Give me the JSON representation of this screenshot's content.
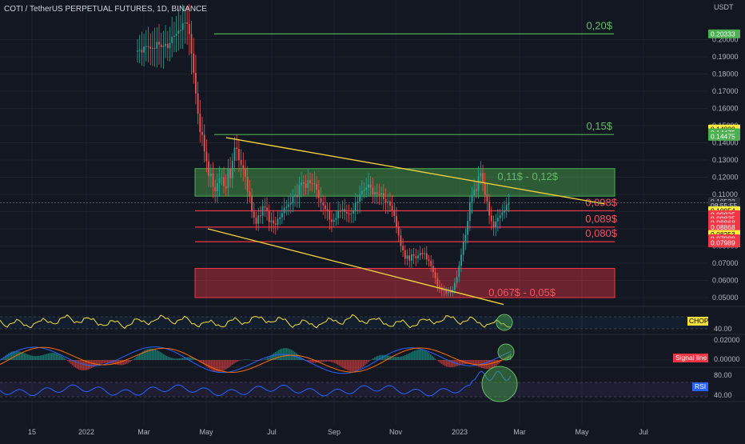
{
  "header": {
    "title": "COTI / TetherUS PERPETUAL FUTURES, 1D, BINANCE",
    "currency": "USDT"
  },
  "colors": {
    "background": "#131722",
    "grid": "#1e222d",
    "green_level": "#4caf50",
    "green_text": "#66bb6a",
    "red_level": "#f23645",
    "red_text": "#f7525f",
    "zone_green_fill": "rgba(76,175,80,0.45)",
    "zone_red_fill": "rgba(242,54,69,0.40)",
    "trendline": "#f0d03c",
    "candle_up": "#26a69a",
    "candle_down": "#ef5350",
    "chop_line": "#f5e03c",
    "rsi_line": "#2962ff",
    "macd_line": "#2962ff",
    "signal_line": "#ff6d00",
    "highlight": "rgba(76,175,80,0.45)"
  },
  "chart_data": {
    "type": "candlestick",
    "x_ticks": [
      "15",
      "2022",
      "Mar",
      "May",
      "Jul",
      "Sep",
      "Nov",
      "2023",
      "Mar",
      "May",
      "Jul"
    ],
    "y_ticks": [
      "0.20000",
      "0.19000",
      "0.18000",
      "0.17000",
      "0.16000",
      "0.15000",
      "0.14000",
      "0.13000",
      "0.12000",
      "0.11000",
      "0.10000",
      "0.09000",
      "0.08000",
      "0.07000",
      "0.06000",
      "0.05000"
    ],
    "ylim": [
      0.049,
      0.212
    ],
    "horizontal_levels": [
      {
        "value": 0.2033,
        "label": "0,20$",
        "color": "green"
      },
      {
        "value": 0.1448,
        "label": "0,15$",
        "color": "green"
      },
      {
        "value": 0.1005,
        "label": "0,098$",
        "color": "red"
      },
      {
        "value": 0.091,
        "label": "0,089$",
        "color": "red"
      },
      {
        "value": 0.0825,
        "label": "0,080$",
        "color": "red"
      }
    ],
    "zones": [
      {
        "top": 0.125,
        "bottom": 0.109,
        "label": "0,11$ - 0,12$",
        "color": "green"
      },
      {
        "top": 0.067,
        "bottom": 0.05,
        "label": "0,067$ - 0,05$",
        "color": "red"
      }
    ],
    "trendlines": [
      {
        "from": {
          "x": "May 2022",
          "y": 0.143
        },
        "to": {
          "x": "Apr 2023",
          "y": 0.105
        }
      },
      {
        "from": {
          "x": "Apr 2022",
          "y": 0.09
        },
        "to": {
          "x": "Feb 2023",
          "y": 0.046
        }
      }
    ],
    "price_badges": [
      {
        "text": "0.20333",
        "bg": "#4caf50",
        "fg": "#ffffff",
        "value": 0.20333
      },
      {
        "text": "0.14800",
        "bg": "#ffeb3b",
        "fg": "#000000",
        "value": 0.148
      },
      {
        "text": "0.14475",
        "bg": "#4caf50",
        "fg": "#ffffff",
        "value": 0.1458
      },
      {
        "text": "0.14475",
        "bg": "#4caf50",
        "fg": "#ffffff",
        "value": 0.1438
      },
      {
        "text": "0.10522",
        "bg": "#2a2e39",
        "fg": "#d1d4dc",
        "value": 0.1058
      },
      {
        "text": "08:55:55",
        "bg": "#2a2e39",
        "fg": "#d1d4dc",
        "value": 0.1035
      },
      {
        "text": "0.10054",
        "bg": "#ffeb3b",
        "fg": "#000000",
        "value": 0.1005
      },
      {
        "text": "0.09835",
        "bg": "#f23645",
        "fg": "#ffffff",
        "value": 0.0982
      },
      {
        "text": "0.09835",
        "bg": "#f23645",
        "fg": "#ffffff",
        "value": 0.0958
      },
      {
        "text": "0.08868",
        "bg": "#f23645",
        "fg": "#ffffff",
        "value": 0.0934
      },
      {
        "text": "0.08868",
        "bg": "#f23645",
        "fg": "#ffffff",
        "value": 0.091
      },
      {
        "text": "0.08253",
        "bg": "#ffeb3b",
        "fg": "#000000",
        "value": 0.0867
      },
      {
        "text": "0.07989",
        "bg": "#f23645",
        "fg": "#ffffff",
        "value": 0.0842
      },
      {
        "text": "0.07989",
        "bg": "#f23645",
        "fg": "#ffffff",
        "value": 0.0818
      }
    ],
    "candles_close": [
      0.1935,
      0.194,
      0.1925,
      0.196,
      0.1962,
      0.1958,
      0.1948,
      0.1952,
      0.1948,
      0.1987,
      0.1971,
      0.1956,
      0.1963,
      0.1976,
      0.195,
      0.198,
      0.2016,
      0.2022,
      0.2035,
      0.2052,
      0.2056,
      0.2095,
      0.2099,
      0.2092,
      0.2033,
      0.1919,
      0.1807,
      0.1687,
      0.157,
      0.1463,
      0.1446,
      0.1349,
      0.1293,
      0.1206,
      0.1221,
      0.1144,
      0.1119,
      0.1166,
      0.1195,
      0.12,
      0.1148,
      0.1135,
      0.1252,
      0.1194,
      0.1295,
      0.1372,
      0.1365,
      0.13,
      0.1271,
      0.1249,
      0.1202,
      0.1116,
      0.1089,
      0.1,
      0.0965,
      0.0929,
      0.0978,
      0.0976,
      0.103,
      0.1023,
      0.1002,
      0.0939,
      0.0948,
      0.0931,
      0.0924,
      0.0957,
      0.0967,
      0.0991,
      0.1022,
      0.1028,
      0.1041,
      0.1051,
      0.1087,
      0.1097,
      0.1085,
      0.1154,
      0.117,
      0.1163,
      0.1138,
      0.1183,
      0.1166,
      0.1165,
      0.116,
      0.1127,
      0.1078,
      0.1053,
      0.1036,
      0.1015,
      0.1007,
      0.0953,
      0.094,
      0.0953,
      0.0962,
      0.1004,
      0.1003,
      0.1014,
      0.0998,
      0.0989,
      0.0987,
      0.0989,
      0.1006,
      0.105,
      0.1058,
      0.1099,
      0.1119,
      0.1126,
      0.114,
      0.1158,
      0.1138,
      0.11,
      0.1113,
      0.1101,
      0.1099,
      0.1107,
      0.1073,
      0.1052,
      0.106,
      0.1034,
      0.1006,
      0.0975,
      0.0913,
      0.0862,
      0.0801,
      0.0775,
      0.0726,
      0.0745,
      0.0715,
      0.0752,
      0.0741,
      0.0728,
      0.0745,
      0.076,
      0.0753,
      0.0758,
      0.0721,
      0.0713,
      0.0684,
      0.0648,
      0.0613,
      0.0568,
      0.0559,
      0.054,
      0.0543,
      0.0526,
      0.0536,
      0.0528,
      0.0546,
      0.0586,
      0.0621,
      0.0685,
      0.0749,
      0.0824,
      0.0866,
      0.0946,
      0.1055,
      0.1095,
      0.113,
      0.1121,
      0.1206,
      0.1224,
      0.1168,
      0.1098,
      0.1058,
      0.0977,
      0.0944,
      0.091,
      0.0943,
      0.0962,
      0.0978,
      0.0995,
      0.1005,
      0.104,
      0.1052
    ],
    "candles_start_month": "Nov 2021",
    "indicators": [
      {
        "name": "CHOP",
        "marker": "40.00",
        "color": "#f5e03c"
      },
      {
        "name": "MACD",
        "label": "Signal line",
        "marker": "0.00000",
        "top_tick": "0.02000",
        "color": "#2962ff"
      },
      {
        "name": "RSI",
        "label": "RSI",
        "ticks": [
          "80.00",
          "40.00"
        ],
        "color": "#2962ff"
      }
    ]
  }
}
